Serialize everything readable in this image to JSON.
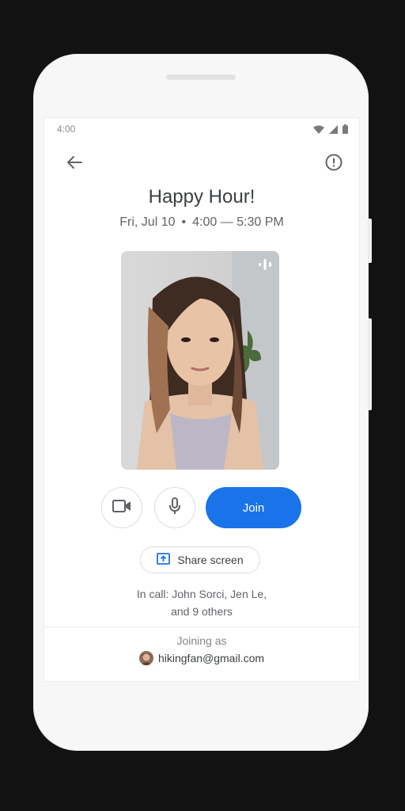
{
  "status_bar": {
    "time": "4:00",
    "icons": [
      "wifi-icon",
      "cell-signal-icon",
      "battery-icon"
    ]
  },
  "header": {
    "back_icon": "arrow-back-icon",
    "info_icon": "report-icon"
  },
  "meeting": {
    "title": "Happy Hour!",
    "date": "Fri, Jul 10",
    "separator": "•",
    "time_range": "4:00 — 5:30 PM"
  },
  "preview": {
    "audio_indicator_icon": "audio-level-icon"
  },
  "controls": {
    "camera_icon": "videocam-icon",
    "mic_icon": "mic-icon",
    "join_label": "Join"
  },
  "share": {
    "icon": "present-to-all-icon",
    "label": "Share screen"
  },
  "in_call": {
    "label": "In call:",
    "names_line1": "John Sorci, Jen Le,",
    "names_line2": "and 9 others"
  },
  "account": {
    "joining_as": "Joining as",
    "email": "hikingfan@gmail.com"
  },
  "colors": {
    "accent": "#1a73e8",
    "background": "#121212",
    "text_primary": "#3c4043",
    "text_secondary": "#5f6368"
  }
}
